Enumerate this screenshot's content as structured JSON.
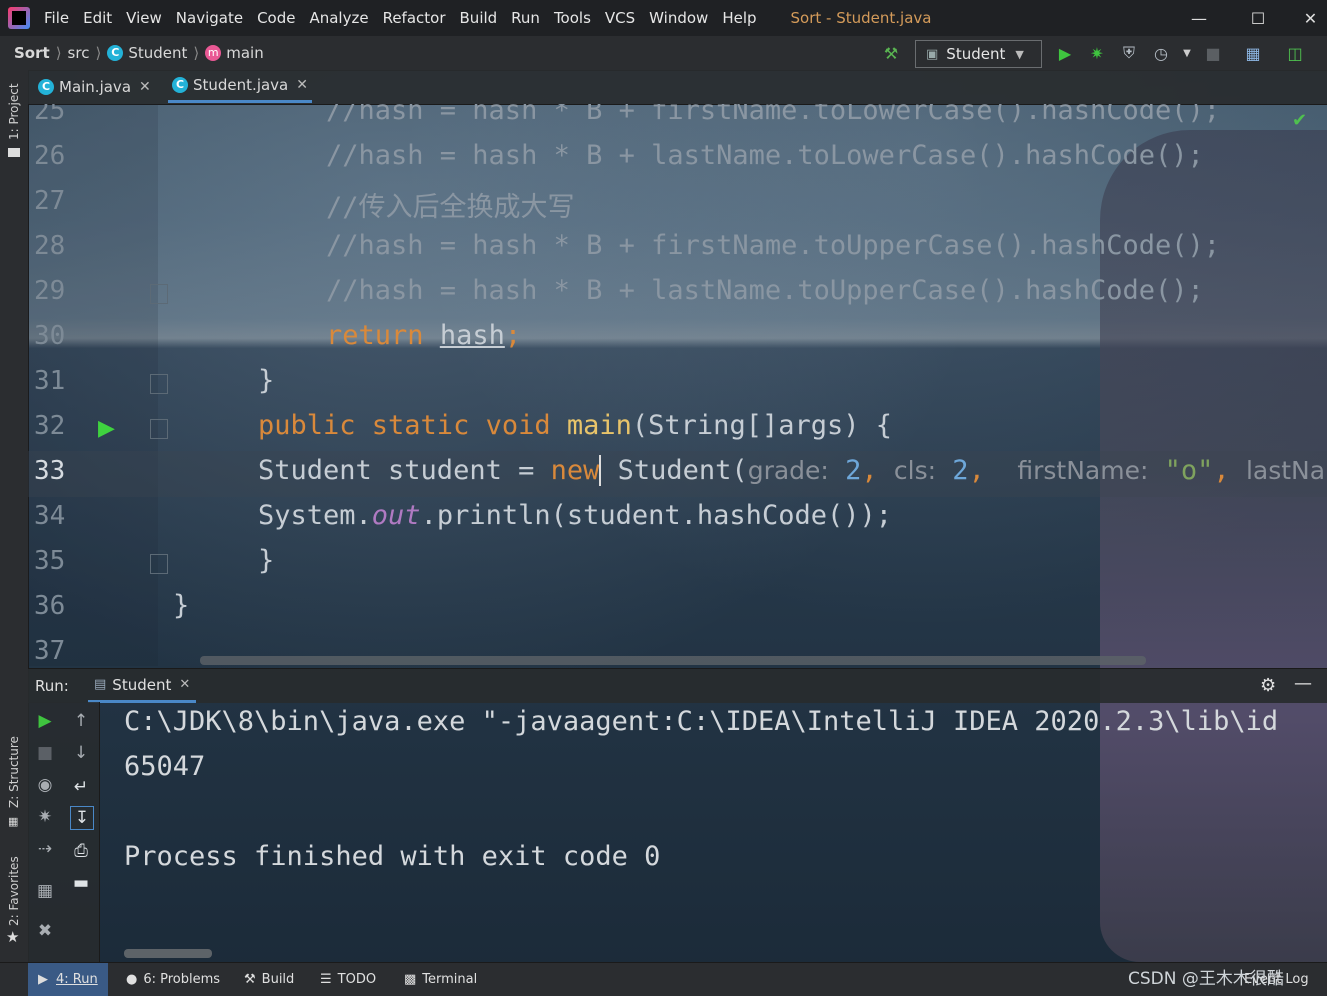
{
  "menu": {
    "items": [
      "File",
      "Edit",
      "View",
      "Navigate",
      "Code",
      "Analyze",
      "Refactor",
      "Build",
      "Run",
      "Tools",
      "VCS",
      "Window",
      "Help"
    ],
    "window_title": "Sort - Student.java"
  },
  "nav": {
    "project": "Sort",
    "folder": "src",
    "class": "Student",
    "method": "main",
    "run_config": "Student"
  },
  "left_stripe": {
    "project": "1: Project",
    "structure": "Z: Structure",
    "favorites": "2: Favorites"
  },
  "tabs": [
    {
      "label": "Main.java",
      "active": false
    },
    {
      "label": "Student.java",
      "active": true
    }
  ],
  "editor": {
    "line_numbers": [
      "25",
      "26",
      "27",
      "28",
      "29",
      "30",
      "31",
      "32",
      "33",
      "34",
      "35",
      "36",
      "37"
    ],
    "current_line": "33",
    "lines": {
      "l25": "//hash = hash * B + firstName.toLowerCase().hashCode();",
      "l26": "//hash = hash * B + lastName.toLowerCase().hashCode();",
      "l27": "//传入后全换成大写",
      "l28": "//hash = hash * B + firstName.toUpperCase().hashCode();",
      "l29": "//hash = hash * B + lastName.toUpperCase().hashCode();",
      "l30_kw": "return",
      "l30_var": "hash",
      "l31": "}",
      "l32_kw": "public static void",
      "l32_fn": "main",
      "l32_rest": "(String[]args) {",
      "l33_a": "Student student = ",
      "l33_new": "new",
      "l33_b": " Student(",
      "l33_hint1": "grade:",
      "l33_v1": "2",
      "l33_hint2": "cls:",
      "l33_v2": "2",
      "l33_hint3": "firstName:",
      "l33_v3": "\"o\"",
      "l33_hint4": "lastNa",
      "l34_a": "System.",
      "l34_out": "out",
      "l34_b": ".println(student.hashCode());",
      "l35": "}",
      "l36": "}"
    }
  },
  "run_panel": {
    "label": "Run:",
    "tab": "Student",
    "output": [
      "C:\\JDK\\8\\bin\\java.exe \"-javaagent:C:\\IDEA\\IntelliJ IDEA 2020.2.3\\lib\\id",
      "65047",
      "",
      "Process finished with exit code 0"
    ]
  },
  "status_bar": {
    "run": "4: Run",
    "problems": "6: Problems",
    "build": "Build",
    "todo": "TODO",
    "terminal": "Terminal",
    "event_log": "Event Log",
    "watermark": "CSDN @王木木很酷"
  },
  "colors": {
    "keyword": "#d9893b",
    "function": "#e8c46a",
    "number": "#6ea7d9",
    "string": "#7fa35e",
    "accent": "#4a88c7",
    "run_green": "#3fc43f"
  }
}
